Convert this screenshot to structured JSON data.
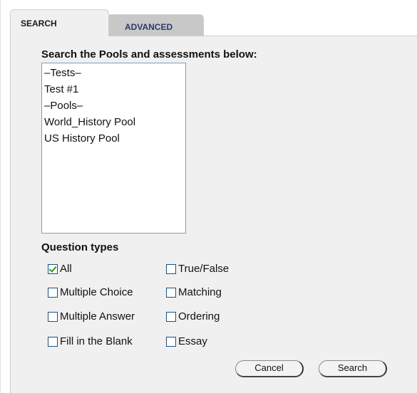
{
  "tabs": {
    "search": "SEARCH",
    "advanced": "ADVANCED"
  },
  "heading": "Search the Pools and assessments below:",
  "listbox": {
    "options": [
      "–Tests–",
      "Test #1",
      "–Pools–",
      "World_History Pool",
      "US History Pool"
    ]
  },
  "question_types": {
    "label": "Question types",
    "items": [
      {
        "label": "All",
        "checked": true
      },
      {
        "label": "True/False",
        "checked": false
      },
      {
        "label": "Multiple Choice",
        "checked": false
      },
      {
        "label": "Matching",
        "checked": false
      },
      {
        "label": "Multiple Answer",
        "checked": false
      },
      {
        "label": "Ordering",
        "checked": false
      },
      {
        "label": "Fill in the Blank",
        "checked": false
      },
      {
        "label": "Essay",
        "checked": false
      }
    ]
  },
  "buttons": {
    "cancel": "Cancel",
    "search": "Search"
  }
}
